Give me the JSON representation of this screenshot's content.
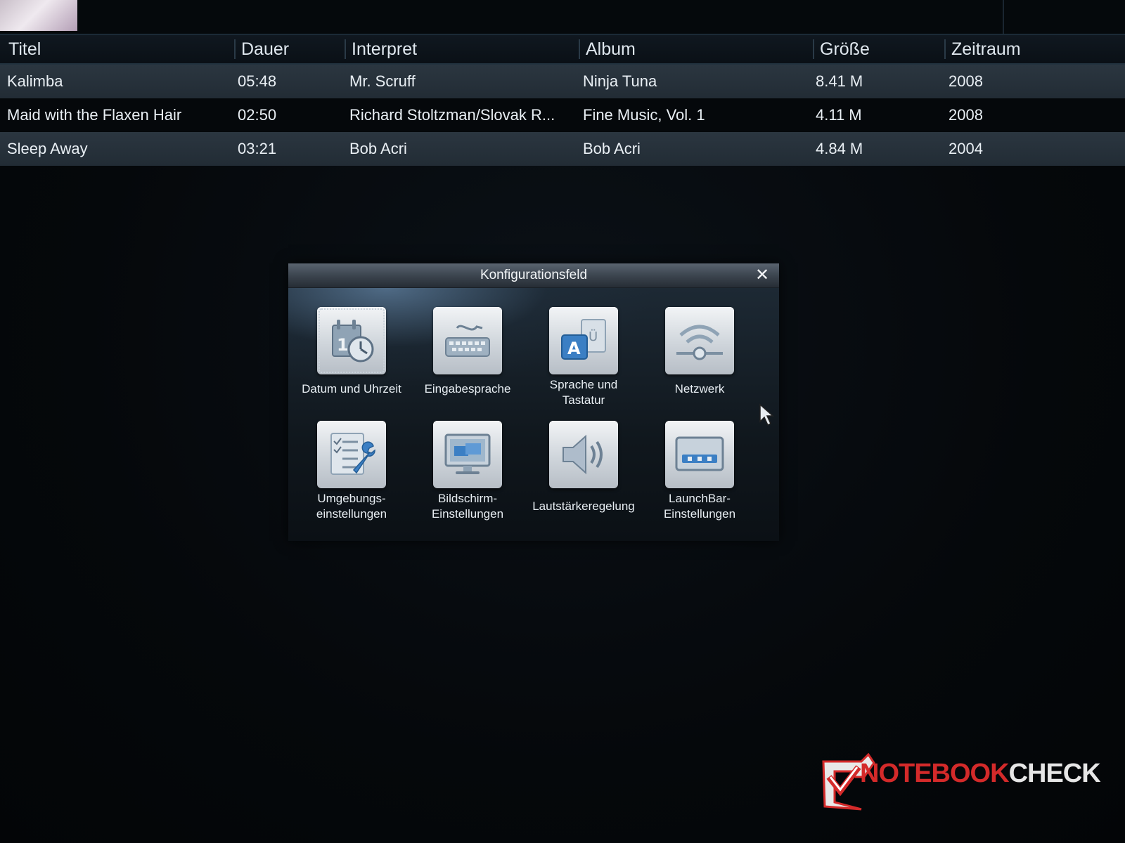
{
  "table": {
    "headers": {
      "title": "Titel",
      "duration": "Dauer",
      "artist": "Interpret",
      "album": "Album",
      "size": "Größe",
      "period": "Zeitraum"
    },
    "rows": [
      {
        "title": "Kalimba",
        "duration": "05:48",
        "artist": "Mr. Scruff",
        "album": "Ninja Tuna",
        "size": "8.41 M",
        "year": "2008"
      },
      {
        "title": "Maid with the Flaxen Hair",
        "duration": "02:50",
        "artist": "Richard Stoltzman/Slovak R...",
        "album": "Fine Music, Vol. 1",
        "size": "4.11 M",
        "year": "2008"
      },
      {
        "title": "Sleep Away",
        "duration": "03:21",
        "artist": "Bob Acri",
        "album": "Bob Acri",
        "size": "4.84 M",
        "year": "2004"
      }
    ]
  },
  "dialog": {
    "title": "Konfigurationsfeld",
    "close_icon": "close-icon",
    "items": [
      {
        "line1": "Datum und Uhrzeit",
        "line2": "",
        "icon": "calendar-clock-icon",
        "selected": true
      },
      {
        "line1": "Eingabesprache",
        "line2": "",
        "icon": "keyboard-icon",
        "selected": false
      },
      {
        "line1": "Sprache und",
        "line2": "Tastatur",
        "icon": "language-keyboard-icon",
        "selected": false
      },
      {
        "line1": "Netzwerk",
        "line2": "",
        "icon": "wifi-network-icon",
        "selected": false
      },
      {
        "line1": "Umgebungs-",
        "line2": "einstellungen",
        "icon": "checklist-wrench-icon",
        "selected": false
      },
      {
        "line1": "Bildschirm-",
        "line2": "Einstellungen",
        "icon": "monitor-icon",
        "selected": false
      },
      {
        "line1": "Lautstärkeregelung",
        "line2": "",
        "icon": "speaker-volume-icon",
        "selected": false
      },
      {
        "line1": "LaunchBar-",
        "line2": "Einstellungen",
        "icon": "launchbar-icon",
        "selected": false
      }
    ]
  },
  "watermark": {
    "brand_part1": "NOTEBOOK",
    "brand_part2": "CHECK",
    "color_red": "#d42a2a",
    "color_gray": "#e6e6e6"
  },
  "colors": {
    "row_highlight": "#2b3640",
    "background": "#05080b",
    "dialog_titlebar": "#3c454f"
  }
}
